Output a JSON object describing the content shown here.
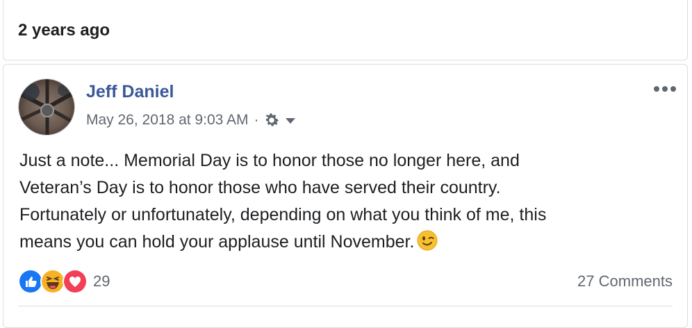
{
  "header": {
    "label": "2 years ago"
  },
  "post": {
    "author": "Jeff Daniel",
    "date": "May 26, 2018 at 9:03 AM",
    "separator": "·",
    "audience_icon": "gear-icon",
    "text": "Just a note... Memorial Day is to honor those no longer here, and\nVeteran’s Day is to honor those who have served their country.\nFortunately or unfortunately, depending on what you think of me, this\nmeans you can hold your applause until November.",
    "trailing_emoji": "winking-face-emoji"
  },
  "footer": {
    "reactions": [
      "like",
      "haha",
      "love"
    ],
    "reaction_count": "29",
    "comments_label": "27 Comments"
  },
  "colors": {
    "author_link": "#385898",
    "secondary_text": "#606770",
    "like_blue": "#1877f2",
    "love_red": "#f33e58",
    "haha_yellow": "#f7b125"
  }
}
